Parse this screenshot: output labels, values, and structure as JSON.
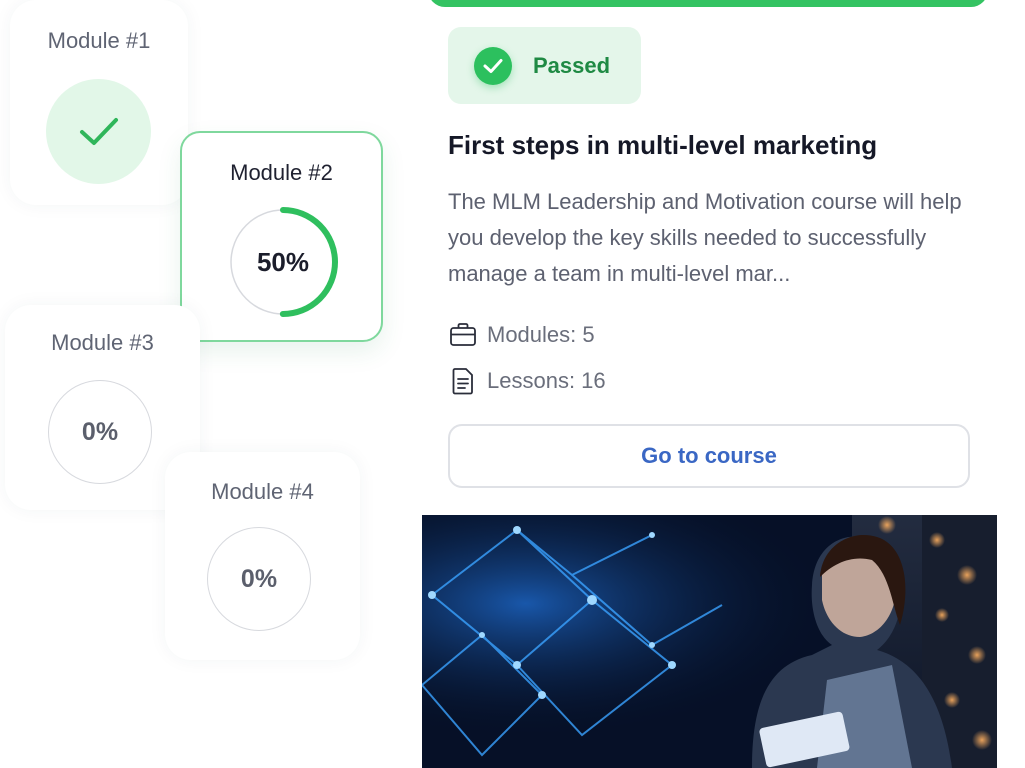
{
  "modules": [
    {
      "title": "Module #1",
      "status": "completed"
    },
    {
      "title": "Module #2",
      "progress_label": "50%",
      "progress": 0.5
    },
    {
      "title": "Module #3",
      "progress_label": "0%",
      "progress": 0
    },
    {
      "title": "Module #4",
      "progress_label": "0%",
      "progress": 0
    }
  ],
  "course": {
    "badge_label": "Passed",
    "title": "First steps in multi-level marketing",
    "description": "The MLM Leadership and Motivation course will help you develop the key skills needed to successfully manage a team in multi-level mar...",
    "modules_label": "Modules: 5",
    "lessons_label": "Lessons: 16",
    "cta_label": "Go to course",
    "icons": {
      "modules": "briefcase-icon",
      "lessons": "document-icon",
      "badge": "check-circle-icon"
    }
  },
  "colors": {
    "accent_green": "#34c362",
    "badge_bg": "#e4f6ea",
    "link_blue": "#3a67c4"
  }
}
